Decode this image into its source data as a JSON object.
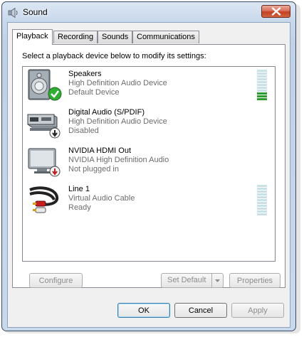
{
  "window": {
    "title": "Sound",
    "icon": "speaker-icon",
    "close_icon": "close-icon"
  },
  "tabs": [
    {
      "label": "Playback",
      "active": true
    },
    {
      "label": "Recording",
      "active": false
    },
    {
      "label": "Sounds",
      "active": false
    },
    {
      "label": "Communications",
      "active": false
    }
  ],
  "panel": {
    "instruction": "Select a playback device below to modify its settings:"
  },
  "devices": [
    {
      "name": "Speakers",
      "line1": "High Definition Audio Device",
      "line2": "Default Device",
      "icon": "speaker-default-icon",
      "status_icon": "checkmark-icon",
      "meter_level": 0.27
    },
    {
      "name": "Digital Audio (S/PDIF)",
      "line1": "High Definition Audio Device",
      "line2": "Disabled",
      "icon": "digital-audio-receiver-icon",
      "status_icon": "disabled-arrow-icon"
    },
    {
      "name": "NVIDIA HDMI Out",
      "line1": "NVIDIA High Definition Audio",
      "line2": "Not plugged in",
      "icon": "monitor-icon",
      "status_icon": "unplugged-icon"
    },
    {
      "name": "Line 1",
      "line1": "Virtual Audio Cable",
      "line2": "Ready",
      "icon": "rca-cable-icon",
      "meter_level": 0
    }
  ],
  "panel_buttons": {
    "configure": "Configure",
    "set_default": "Set Default",
    "properties": "Properties"
  },
  "dialog_buttons": {
    "ok": "OK",
    "cancel": "Cancel",
    "apply": "Apply"
  },
  "colors": {
    "meter_on": "#2f9a2f",
    "meter_off": "#c9e2e9",
    "checkmark": "#2fae33"
  }
}
